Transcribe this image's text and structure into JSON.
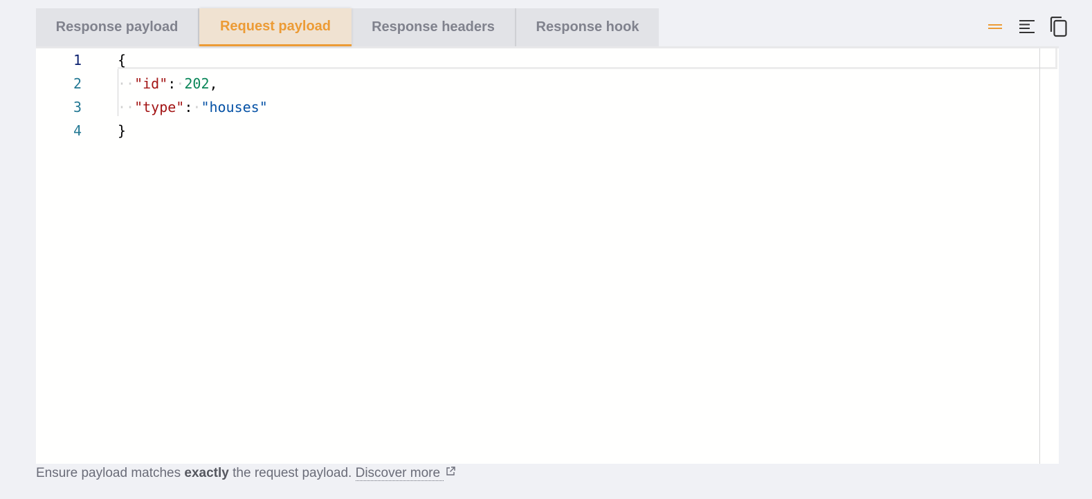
{
  "tabs": [
    {
      "label": "Response payload",
      "active": false
    },
    {
      "label": "Request payload",
      "active": true
    },
    {
      "label": "Response headers",
      "active": false
    },
    {
      "label": "Response hook",
      "active": false
    }
  ],
  "toolbar": {
    "icons": [
      "wrap-lines-icon",
      "format-icon",
      "copy-icon"
    ],
    "accent_color": "#ec9b35"
  },
  "editor": {
    "line_numbers": [
      "1",
      "2",
      "3",
      "4"
    ],
    "lines": {
      "l1": {
        "brace": "{"
      },
      "l2": {
        "key": "\"id\"",
        "colon": ":",
        "value": "202",
        "comma": ","
      },
      "l3": {
        "key": "\"type\"",
        "colon": ":",
        "value": "\"houses\""
      },
      "l4": {
        "brace": "}"
      }
    }
  },
  "footer": {
    "text_before": "Ensure payload matches ",
    "text_bold": "exactly",
    "text_after": " the request payload. ",
    "link_label": "Discover more "
  }
}
